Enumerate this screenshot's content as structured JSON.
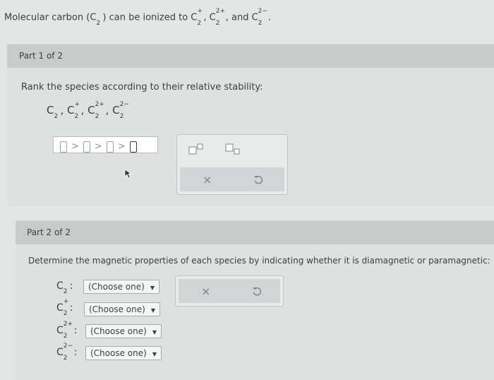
{
  "intro": {
    "text_before": "Molecular carbon (C",
    "text_after_paren": ") can be ionized to C",
    "and_text": ", and C",
    "end": "."
  },
  "part1": {
    "title": "Part 1 of 2",
    "prompt": "Rank the species according to their relative stability:",
    "species_list": [
      "C2",
      "C2+",
      "C2 2+",
      "C2 2-"
    ],
    "answer_sep": ">",
    "toolbox": {
      "superscript_icon": "superscript-icon",
      "subscript_icon": "subscript-icon",
      "clear_label": "×",
      "undo_icon": "undo-icon"
    }
  },
  "part2": {
    "title": "Part 2 of 2",
    "prompt": "Determine the magnetic properties of each species by indicating whether it is diamagnetic or paramagnetic:",
    "rows": [
      {
        "formula_colon": ":",
        "select": "(Choose one)"
      },
      {
        "formula_colon": ":",
        "select": "(Choose one)"
      },
      {
        "formula_colon": ":",
        "select": "(Choose one)"
      },
      {
        "formula_colon": ":",
        "select": "(Choose one)"
      }
    ],
    "toolbox": {
      "clear_label": "×",
      "undo_icon": "undo-icon"
    }
  },
  "chem": {
    "C": "C",
    "two": "2",
    "plus": "+",
    "twoplus": "2+",
    "twominus": "2−",
    "comma": ","
  }
}
